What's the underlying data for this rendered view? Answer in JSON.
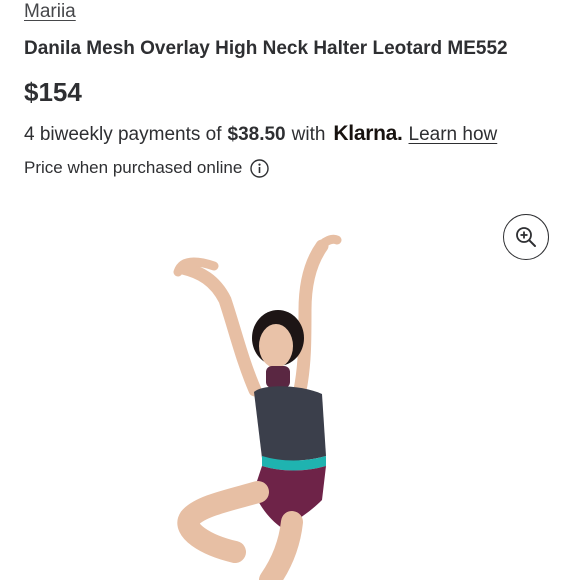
{
  "product": {
    "brand": "Mariia",
    "title": "Danila Mesh Overlay High Neck Halter Leotard ME552",
    "price": "$154"
  },
  "klarna": {
    "prefix": "4 biweekly payments of",
    "amount": "$38.50",
    "with": "with",
    "logo": "Klarna.",
    "link": "Learn how"
  },
  "price_note": "Price when purchased online",
  "icons": {
    "info": "info-icon",
    "zoom": "zoom-in-icon"
  },
  "colors": {
    "text": "#2e2f32",
    "leotard_top": "#3b3f4b",
    "leotard_bottom": "#6e2348",
    "waistband": "#1fb3b0"
  }
}
